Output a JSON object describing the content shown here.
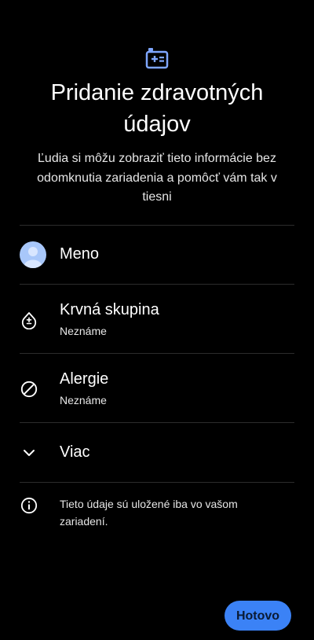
{
  "header": {
    "icon": "medical-id-card-icon",
    "title": "Pridanie zdravotných údajov",
    "subtitle": "Ľudia si môžu zobraziť tieto informácie bez odomknutia zariadenia a pomôcť vám tak v tiesni"
  },
  "items": [
    {
      "icon": "avatar-icon",
      "label": "Meno"
    },
    {
      "icon": "blood-drop-icon",
      "label": "Krvná skupina",
      "value": "Neznáme"
    },
    {
      "icon": "block-icon",
      "label": "Alergie",
      "value": "Neznáme"
    },
    {
      "icon": "chevron-down-icon",
      "label": "Viac"
    }
  ],
  "info": {
    "icon": "info-icon",
    "text": "Tieto údaje sú uložené iba vo vašom zariadení."
  },
  "actions": {
    "done_label": "Hotovo"
  },
  "colors": {
    "accent": "#3b82f6",
    "avatar": "#a8c7fa",
    "background": "#000000"
  }
}
